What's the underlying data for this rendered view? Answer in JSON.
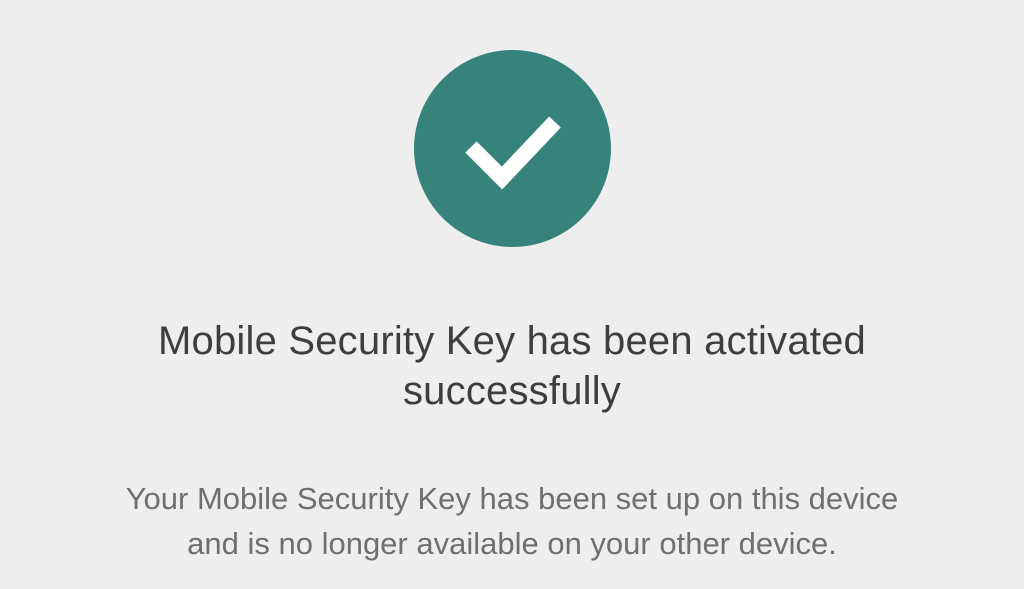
{
  "success": {
    "icon": "checkmark-icon",
    "badge_color": "#35837a",
    "title_lines": [
      "Mobile Security Key has been activated",
      "successfully"
    ],
    "message_lines": [
      "Your Mobile Security Key has been set up on this device",
      "and is no longer available on your other device."
    ]
  },
  "colors": {
    "background": "#eeeeee",
    "title_text": "#3e3e3e",
    "message_text": "#6f6f6f"
  }
}
